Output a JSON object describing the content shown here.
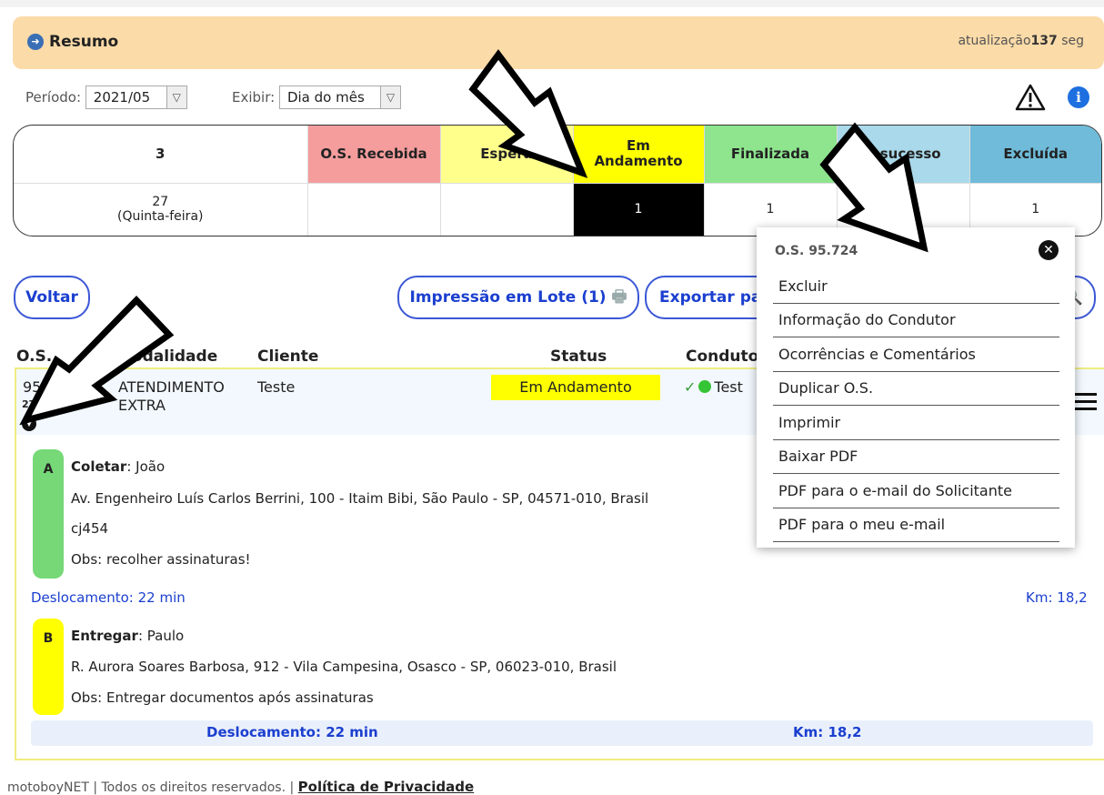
{
  "header": {
    "title": "Resumo",
    "update_label": "atualização",
    "update_value": "137",
    "update_unit": "seg"
  },
  "filters": {
    "period_label": "Período:",
    "period_value": "2021/05",
    "show_label": "Exibir:",
    "show_value": "Dia do mês"
  },
  "summary": {
    "count": "3",
    "columns": [
      "O.S. Recebida",
      "Espera",
      "Em Andamento",
      "Finalizada",
      "Insucesso",
      "Excluída"
    ],
    "column_colors": [
      "#f59d9d",
      "#ffff8c",
      "#ffff00",
      "#8ee58e",
      "#a9d9ea",
      "#6fbbd9"
    ],
    "day": "27",
    "weekday": "(Quinta-feira)",
    "values": [
      "",
      "",
      "1",
      "1",
      "",
      "1"
    ]
  },
  "buttons": {
    "back": "Voltar",
    "batch_print": "Impressão em Lote (1)",
    "export": "Exportar pa"
  },
  "table": {
    "headers": [
      "O.S.",
      "Modalidade",
      "Cliente",
      "Status",
      "Condutor"
    ]
  },
  "order": {
    "number": "95.724",
    "datetime": "27/05 23:34",
    "modality_line1": "ATENDIMENTO",
    "modality_line2": "EXTRA",
    "client": "Teste",
    "status": "Em Andamento",
    "driver": "Test",
    "stops": [
      {
        "letter": "A",
        "action": "Coletar",
        "person": ": João",
        "address": "Av. Engenheiro Luís Carlos Berrini, 100 - Itaim Bibi, São Paulo - SP, 04571-010, Brasil",
        "complement": "cj454",
        "obs": "Obs: recolher assinaturas!",
        "color": "#76d876"
      },
      {
        "letter": "B",
        "action": "Entregar",
        "person": ": Paulo",
        "address": "R. Aurora Soares Barbosa, 912 - Vila Campesina, Osasco - SP, 06023-010, Brasil",
        "obs": "Obs: Entregar documentos após assinaturas",
        "color": "#ffff00"
      }
    ],
    "leg_time": "Deslocamento: 22 min",
    "leg_km": "Km: 18,2",
    "total_time": "Deslocamento: 22 min",
    "total_km": "Km: 18,2"
  },
  "menu": {
    "title": "O.S. 95.724",
    "items": [
      "Excluir",
      "Informação do Condutor",
      "Ocorrências e Comentários",
      "Duplicar O.S.",
      "Imprimir",
      "Baixar PDF",
      "PDF para o e-mail do Solicitante",
      "PDF para o meu e-mail"
    ]
  },
  "footer": {
    "text": "motoboyNET | Todos os direitos reservados. |",
    "link": "Política de Privacidade"
  },
  "icons": [
    "info-icon",
    "warning-icon",
    "info-circle-icon",
    "printer-icon",
    "search-icon",
    "hamburger-icon",
    "close-icon",
    "collapse-icon",
    "check-icon",
    "status-dot-icon"
  ]
}
